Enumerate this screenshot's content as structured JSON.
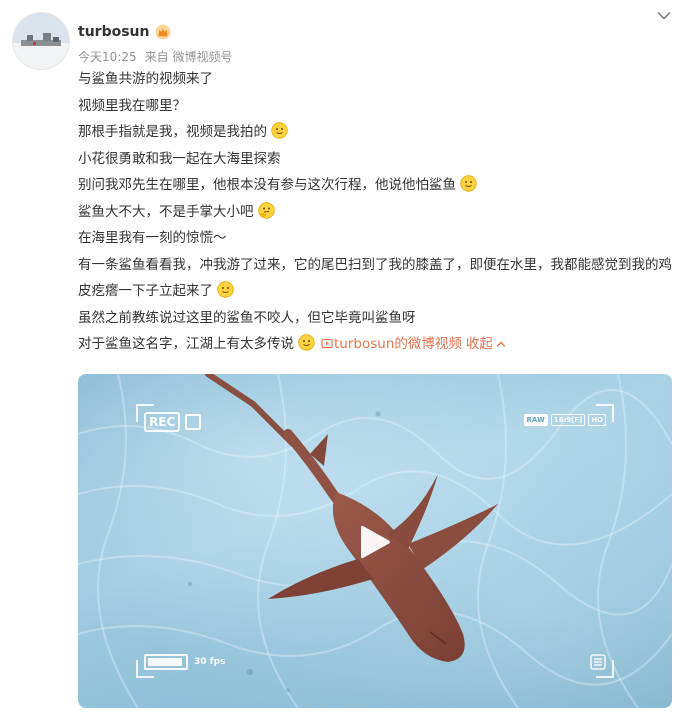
{
  "post": {
    "author": "turbosun",
    "time": "今天10:25",
    "source_prefix": "来自",
    "source": "微博视频号",
    "lines": [
      "与鲨鱼共游的视频来了",
      "视频里我在哪里？",
      "那根手指就是我，视频是我拍的",
      "小花很勇敢和我一起在大海里探索",
      "别问我邓先生在哪里，他根本没有参与这次行程，他说他怕鲨鱼",
      "鲨鱼大不大，不是手掌大小吧",
      "在海里我有一刻的惊慌～",
      "有一条鲨鱼看看我，冲我游了过来，它的尾巴扫到了我的膝盖了，即便在水里，我都能感觉到我的鸡皮疙瘩一下子立起来了",
      "虽然之前教练说过这里的鲨鱼不咬人，但它毕竟叫鲨鱼呀",
      "对于鲨鱼这名字，江湖上有太多传说"
    ],
    "video_link": "turbosun的微博视频",
    "collapse": "收起",
    "icons": {
      "vip": "crown-badge-icon",
      "menu": "chevron-down-icon",
      "smile": "smile-emoji-icon",
      "think": "thinking-emoji-icon",
      "video_link": "video-link-icon"
    }
  },
  "video": {
    "rec_label": "REC",
    "badges": [
      "RAW",
      "16:9[F]",
      "HD"
    ],
    "fps": "30 fps",
    "battery_level": 0.95,
    "icons": {
      "play": "play-icon",
      "settings": "list-icon"
    }
  },
  "colors": {
    "link": "#eb7350",
    "meta": "#939393",
    "text": "#333333"
  }
}
